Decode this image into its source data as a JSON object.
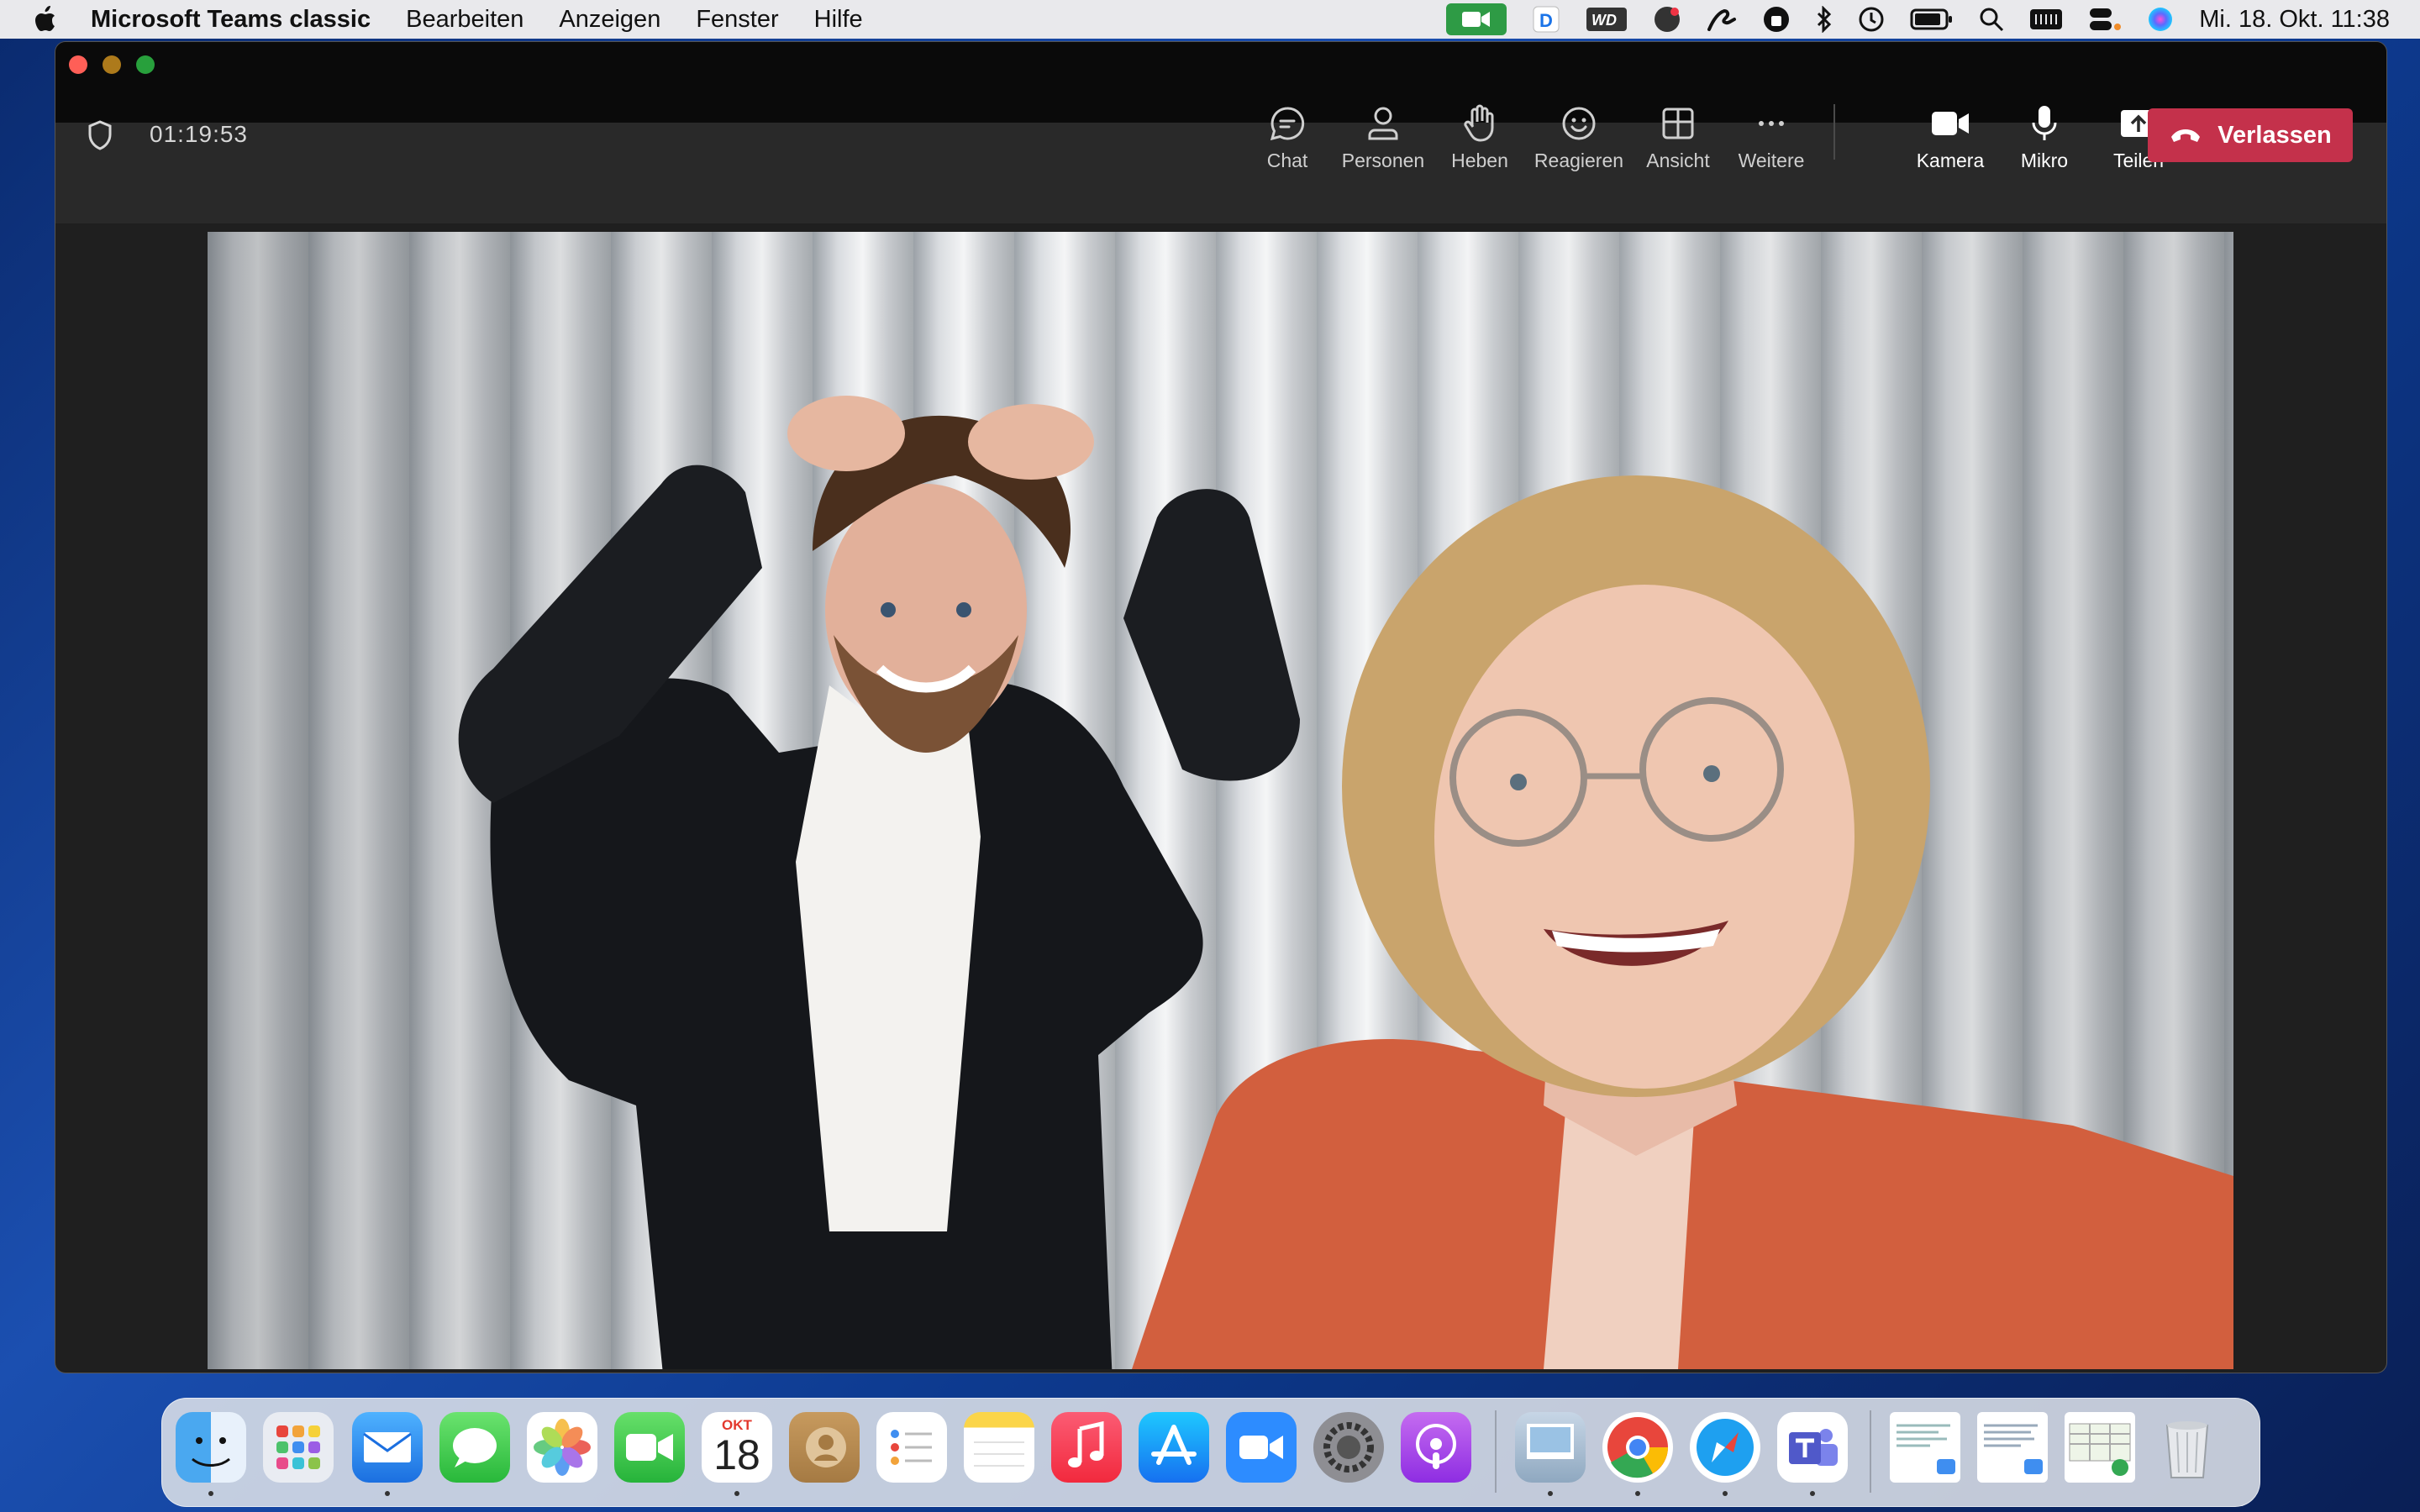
{
  "menubar": {
    "app_name": "Microsoft Teams classic",
    "items": [
      "Bearbeiten",
      "Anzeigen",
      "Fenster",
      "Hilfe"
    ],
    "clock": "Mi. 18. Okt.  11:38",
    "status_icons": [
      "camera-in-use-icon",
      "dockit-icon",
      "wd-icon",
      "meeting-app-icon",
      "pen-icon",
      "vpn-icon",
      "bluetooth-icon",
      "time-machine-icon",
      "battery-icon",
      "spotlight-icon",
      "keyboard-icon",
      "control-center-icon",
      "siri-icon"
    ]
  },
  "call": {
    "timer": "01:19:53",
    "toolbar": {
      "chat": "Chat",
      "people": "Personen",
      "raise": "Heben",
      "react": "Reagieren",
      "view": "Ansicht",
      "more": "Weitere",
      "camera": "Kamera",
      "mic": "Mikro",
      "share": "Teilen",
      "leave": "Verlassen"
    }
  },
  "dock": {
    "apps": [
      "Finder",
      "Launchpad",
      "Mail",
      "Messages",
      "Photos",
      "FaceTime",
      "Calendar",
      "Contacts",
      "Reminders",
      "Notes",
      "Music",
      "App Store",
      "Zoom",
      "System Settings",
      "Podcasts",
      "Preview",
      "Chrome",
      "Safari",
      "Microsoft Teams",
      "Downloads",
      "Documents",
      "Recent Files",
      "Trash"
    ],
    "calendar_month": "OKT",
    "calendar_day": "18"
  },
  "colors": {
    "leave": "#c4314b",
    "camera_indicator": "#2e9b45",
    "toolbar_bg": "#292929"
  }
}
